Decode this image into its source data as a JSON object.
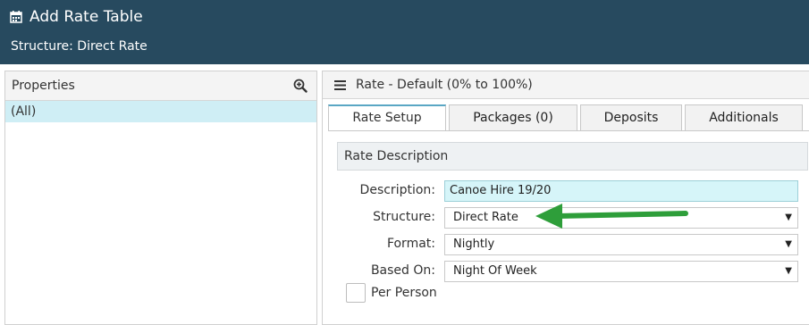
{
  "header": {
    "title": "Add Rate Table",
    "subtitle": "Structure: Direct Rate",
    "icon": "calendar-icon"
  },
  "properties_panel": {
    "title": "Properties",
    "selected_item": "(All)",
    "zoom_icon": "zoom-in-icon"
  },
  "rate_panel": {
    "title": "Rate - Default (0% to 100%)",
    "menu_icon": "hamburger-menu-icon",
    "tabs": [
      {
        "label": "Rate Setup",
        "active": true
      },
      {
        "label": "Packages (0)",
        "active": false
      },
      {
        "label": "Deposits",
        "active": false
      },
      {
        "label": "Additionals",
        "active": false
      }
    ],
    "section_title": "Rate Description",
    "fields": {
      "description": {
        "label": "Description:",
        "value": "Canoe Hire 19/20"
      },
      "structure": {
        "label": "Structure:",
        "value": "Direct Rate"
      },
      "format": {
        "label": "Format:",
        "value": "Nightly"
      },
      "based_on": {
        "label": "Based On:",
        "value": "Night Of Week"
      }
    },
    "per_person": {
      "label": "Per Person",
      "checked": false
    }
  },
  "colors": {
    "header_bg": "#274a5f",
    "selected_row": "#cfeef5",
    "input_bg": "#d6f5f9",
    "active_tab_accent": "#5aa7c4",
    "annotation_arrow": "#2e9e3a"
  }
}
